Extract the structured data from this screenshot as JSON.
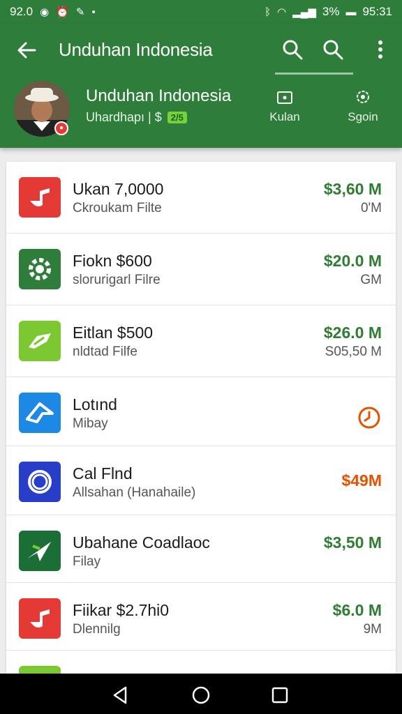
{
  "status_bar": {
    "time": "92.0",
    "battery_text": "3%",
    "clock": "95:31",
    "icons": [
      "bluetooth-icon",
      "wifi-icon",
      "signal-icon",
      "battery-icon"
    ]
  },
  "toolbar": {
    "title": "Unduhan Indonesia",
    "icons": [
      "back-arrow-icon",
      "search-icon",
      "search-icon",
      "more-vert-icon"
    ]
  },
  "profile": {
    "name": "Unduhan Indonesia",
    "subtitle": "Uhardhapı | $",
    "badge": "2/5",
    "tabs": [
      {
        "label": "Kulan",
        "icon": "folder-icon"
      },
      {
        "label": "Sgoin",
        "icon": "settings-gear-icon"
      }
    ]
  },
  "list": [
    {
      "title": "Ukan 7,0000",
      "subtitle": "Ckroukam Filte",
      "price": "$3,60 M",
      "size": "0'M",
      "price_color": "#2e7d32",
      "icon": "music-note-icon",
      "icon_color": "#e53935"
    },
    {
      "title": "Fiokn $600",
      "subtitle": "slorurigarl Filre",
      "price": "$20.0 M",
      "size": "GM",
      "price_color": "#2e7d32",
      "icon": "gear-icon",
      "icon_color": "#2e7d3a"
    },
    {
      "title": "Eitlan $500",
      "subtitle": "nldtad Filfe",
      "price": "$26.0 M",
      "size": "S05,50 M",
      "price_color": "#2e7d32",
      "icon": "flag-arrow-icon",
      "icon_color": "#7cc832"
    },
    {
      "title": "Lotınd",
      "subtitle": "Mibay",
      "price": "",
      "size": "",
      "price_color": "#e65100",
      "icon": "cloud-arrow-icon",
      "icon_color": "#1e88e5",
      "status_icon": "clock-icon"
    },
    {
      "title": "Cal Flnd",
      "subtitle": "Allsahan (Hanahaile)",
      "price": "$49M",
      "size": "",
      "price_color": "#e65100",
      "icon": "ring-icon",
      "icon_color": "#283ec8"
    },
    {
      "title": "Ubahane Coadlaoc",
      "subtitle": "Filay",
      "price": "$3,50 M",
      "size": "",
      "price_color": "#2e7d32",
      "icon": "paper-plane-icon",
      "icon_color": "#1b6e35"
    },
    {
      "title": "Fiikar $2.7hi0",
      "subtitle": "Dlennilg",
      "price": "$6.0 M",
      "size": "9M",
      "price_color": "#2e7d32",
      "icon": "music-note-icon",
      "icon_color": "#e53935"
    },
    {
      "title": "",
      "subtitle": "",
      "price": "",
      "size": "",
      "price_color": "#e65100",
      "icon": "partial-icon",
      "icon_color": "#7cc832"
    }
  ],
  "nav": [
    "back-triangle-icon",
    "home-circle-icon",
    "recents-square-icon"
  ],
  "colors": {
    "primary": "#2e7d3a",
    "accent_green": "#2e7d32",
    "accent_orange": "#e65100"
  }
}
